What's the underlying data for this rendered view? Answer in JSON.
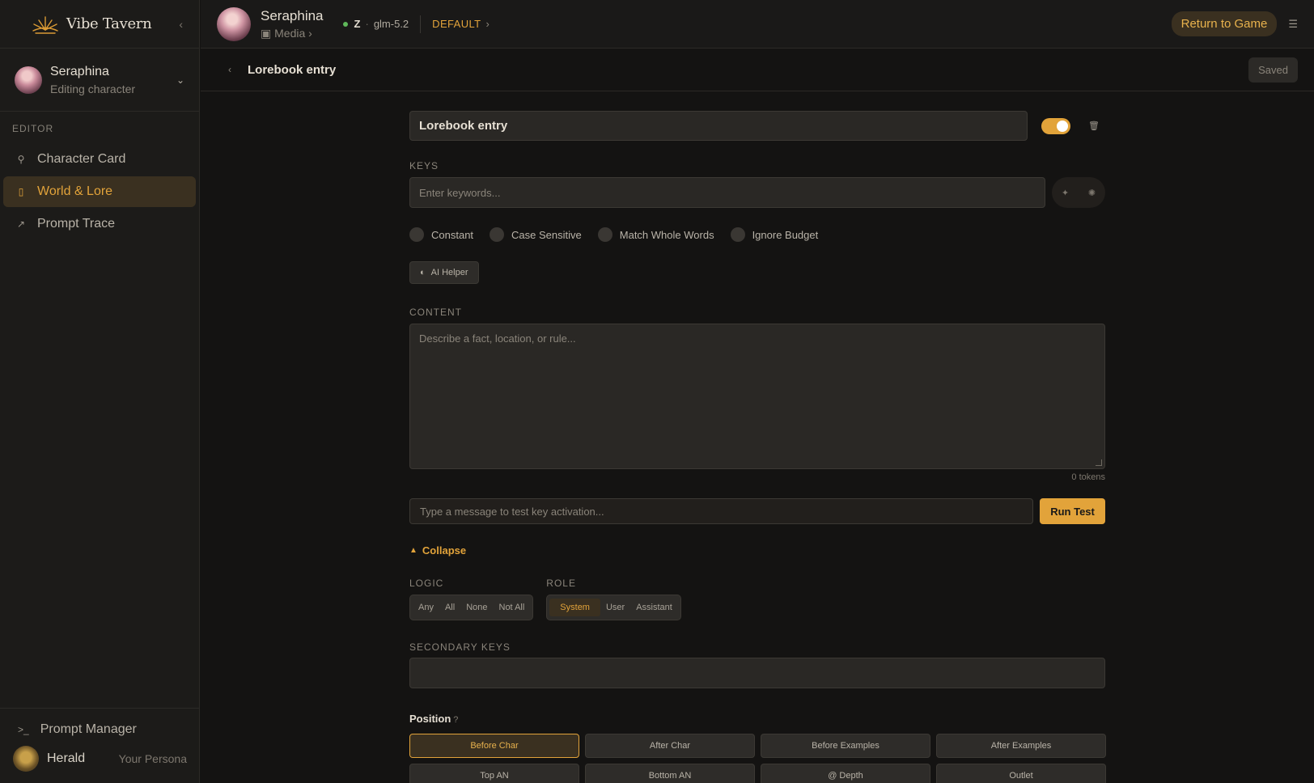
{
  "app": {
    "brand": "Vibe Tavern"
  },
  "sidebar": {
    "character": {
      "name": "Seraphina",
      "status": "Editing character"
    },
    "section_label": "EDITOR",
    "items": [
      {
        "label": "Character Card",
        "icon": "wrench-icon"
      },
      {
        "label": "World & Lore",
        "icon": "book-icon"
      },
      {
        "label": "Prompt Trace",
        "icon": "trend-icon"
      }
    ],
    "prompt_manager": "Prompt Manager",
    "persona": {
      "name": "Herald",
      "role": "Your Persona"
    }
  },
  "topbar": {
    "character": "Seraphina",
    "media": "Media",
    "provider": "Z",
    "model": "glm-5.2",
    "preset": "DEFAULT",
    "return_button": "Return to Game"
  },
  "subbar": {
    "title": "Lorebook entry",
    "status": "Saved"
  },
  "entry": {
    "title": "Lorebook entry",
    "enabled": true,
    "keys_label": "KEYS",
    "keys_placeholder": "Enter keywords...",
    "options": [
      "Constant",
      "Case Sensitive",
      "Match Whole Words",
      "Ignore Budget"
    ],
    "ai_helper": "AI Helper",
    "content_label": "CONTENT",
    "content_placeholder": "Describe a fact, location, or rule...",
    "tokens": "0 tokens",
    "test_placeholder": "Type a message to test key activation...",
    "run_test": "Run Test",
    "collapse": "Collapse",
    "logic_label": "LOGIC",
    "logic_options": [
      "Any",
      "All",
      "None",
      "Not All"
    ],
    "role_label": "ROLE",
    "role_options": [
      "System",
      "User",
      "Assistant"
    ],
    "role_selected": "System",
    "secondary_label": "SECONDARY KEYS",
    "position_label": "Position",
    "position_help": "?",
    "positions": [
      "Before Char",
      "After Char",
      "Before Examples",
      "After Examples",
      "Top AN",
      "Bottom AN",
      "@ Depth",
      "Outlet"
    ],
    "position_selected": "Before Char"
  },
  "colors": {
    "accent": "#e2a33a",
    "background": "#141312",
    "panel": "#1c1b19",
    "status_online": "#5fb85a"
  }
}
